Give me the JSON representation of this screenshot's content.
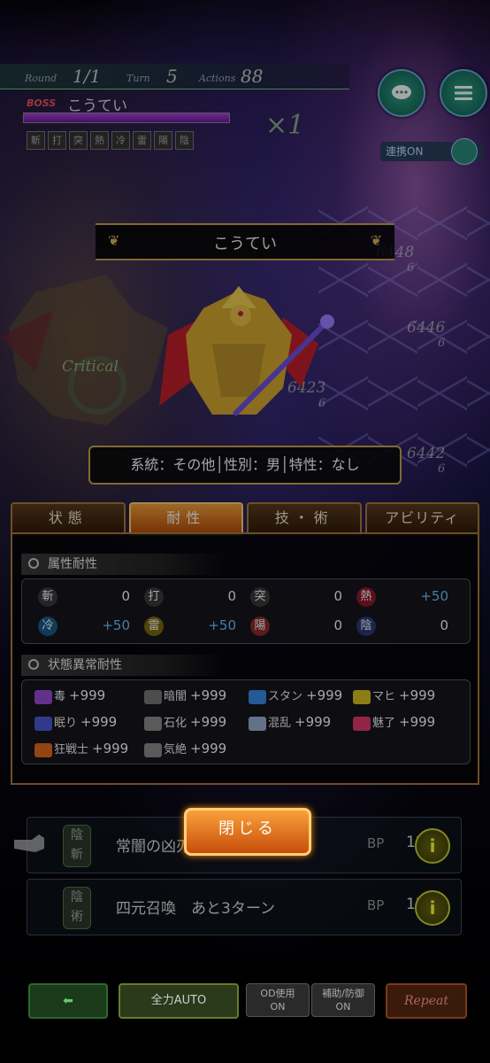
{
  "hud": {
    "round_label": "Round",
    "round_value": "1/1",
    "turn_label": "Turn",
    "turn_value": "5",
    "actions_label": "Actions",
    "actions_value": "88",
    "boss_tag": "BOSS",
    "boss_name": "こうてい",
    "boss_hp_fraction": 1.0,
    "weakness_icons": [
      "斬",
      "打",
      "突",
      "熱",
      "冷",
      "雷",
      "陽",
      "陰"
    ],
    "multiplier": "×1",
    "link_label": "連携ON"
  },
  "enemy": {
    "title": "こうてい",
    "info": "系統：その他│性別：男│特性：なし",
    "critical_text": "Critical",
    "damage_numbers": [
      {
        "value": "6448",
        "hits": "6"
      },
      {
        "value": "6446",
        "hits": "6"
      },
      {
        "value": "6423",
        "hits": "6"
      },
      {
        "value": "6442",
        "hits": "6"
      }
    ]
  },
  "tabs": [
    {
      "label": "状態",
      "active": false
    },
    {
      "label": "耐性",
      "active": true
    },
    {
      "label": "技・術",
      "active": false
    },
    {
      "label": "アビリティ",
      "active": false
    }
  ],
  "elemental": {
    "heading": "属性耐性",
    "items": [
      {
        "icon": "斬",
        "value": "0",
        "color": "#3a3a3a",
        "value_color": "#ffffff"
      },
      {
        "icon": "打",
        "value": "0",
        "color": "#3a3a3a",
        "value_color": "#ffffff"
      },
      {
        "icon": "突",
        "value": "0",
        "color": "#3a3a3a",
        "value_color": "#ffffff"
      },
      {
        "icon": "熱",
        "value": "+50",
        "color": "#8a1a2a",
        "value_color": "#6ec1ff"
      },
      {
        "icon": "冷",
        "value": "+50",
        "color": "#1a5a8a",
        "value_color": "#6ec1ff"
      },
      {
        "icon": "雷",
        "value": "+50",
        "color": "#7a6a10",
        "value_color": "#6ec1ff"
      },
      {
        "icon": "陽",
        "value": "0",
        "color": "#8a2a2a",
        "value_color": "#ffffff"
      },
      {
        "icon": "陰",
        "value": "0",
        "color": "#2a3a7a",
        "value_color": "#ffffff"
      }
    ]
  },
  "status": {
    "heading": "状態異常耐性",
    "items": [
      {
        "name": "毒",
        "value": "+999",
        "icon": "poison-icon",
        "color": "#9a4ad8"
      },
      {
        "name": "暗闇",
        "value": "+999",
        "icon": "eye-icon",
        "color": "#777777"
      },
      {
        "name": "スタン",
        "value": "+999",
        "icon": "stun-icon",
        "color": "#3a8ae8"
      },
      {
        "name": "マヒ",
        "value": "+999",
        "icon": "paralysis-icon",
        "color": "#d8c020"
      },
      {
        "name": "眠り",
        "value": "+999",
        "icon": "sleep-icon",
        "color": "#4a5ad8"
      },
      {
        "name": "石化",
        "value": "+999",
        "icon": "stone-icon",
        "color": "#8a8a8a"
      },
      {
        "name": "混乱",
        "value": "+999",
        "icon": "confusion-icon",
        "color": "#9ab0d0"
      },
      {
        "name": "魅了",
        "value": "+999",
        "icon": "heart-icon",
        "color": "#e03a6a"
      },
      {
        "name": "狂戦士",
        "value": "+999",
        "icon": "berserk-icon",
        "color": "#e06a1a"
      },
      {
        "name": "気絶",
        "value": "+999",
        "icon": "faint-icon",
        "color": "#8a8a8a"
      }
    ]
  },
  "commands": [
    {
      "icon_top": "陰",
      "icon_bottom": "斬",
      "name": "常闇の凶刃",
      "bp_label": "BP",
      "bp": "12"
    },
    {
      "icon_top": "陰",
      "icon_bottom": "術",
      "name": "四元召喚　あと3ターン",
      "bp_label": "BP",
      "bp": "17"
    }
  ],
  "close_label": "閉じる",
  "footer": {
    "auto_label": "全力AUTO",
    "od_label": "OD使用\nON",
    "guard_label": "補助/防御\nON",
    "repeat_label": "Repeat"
  }
}
